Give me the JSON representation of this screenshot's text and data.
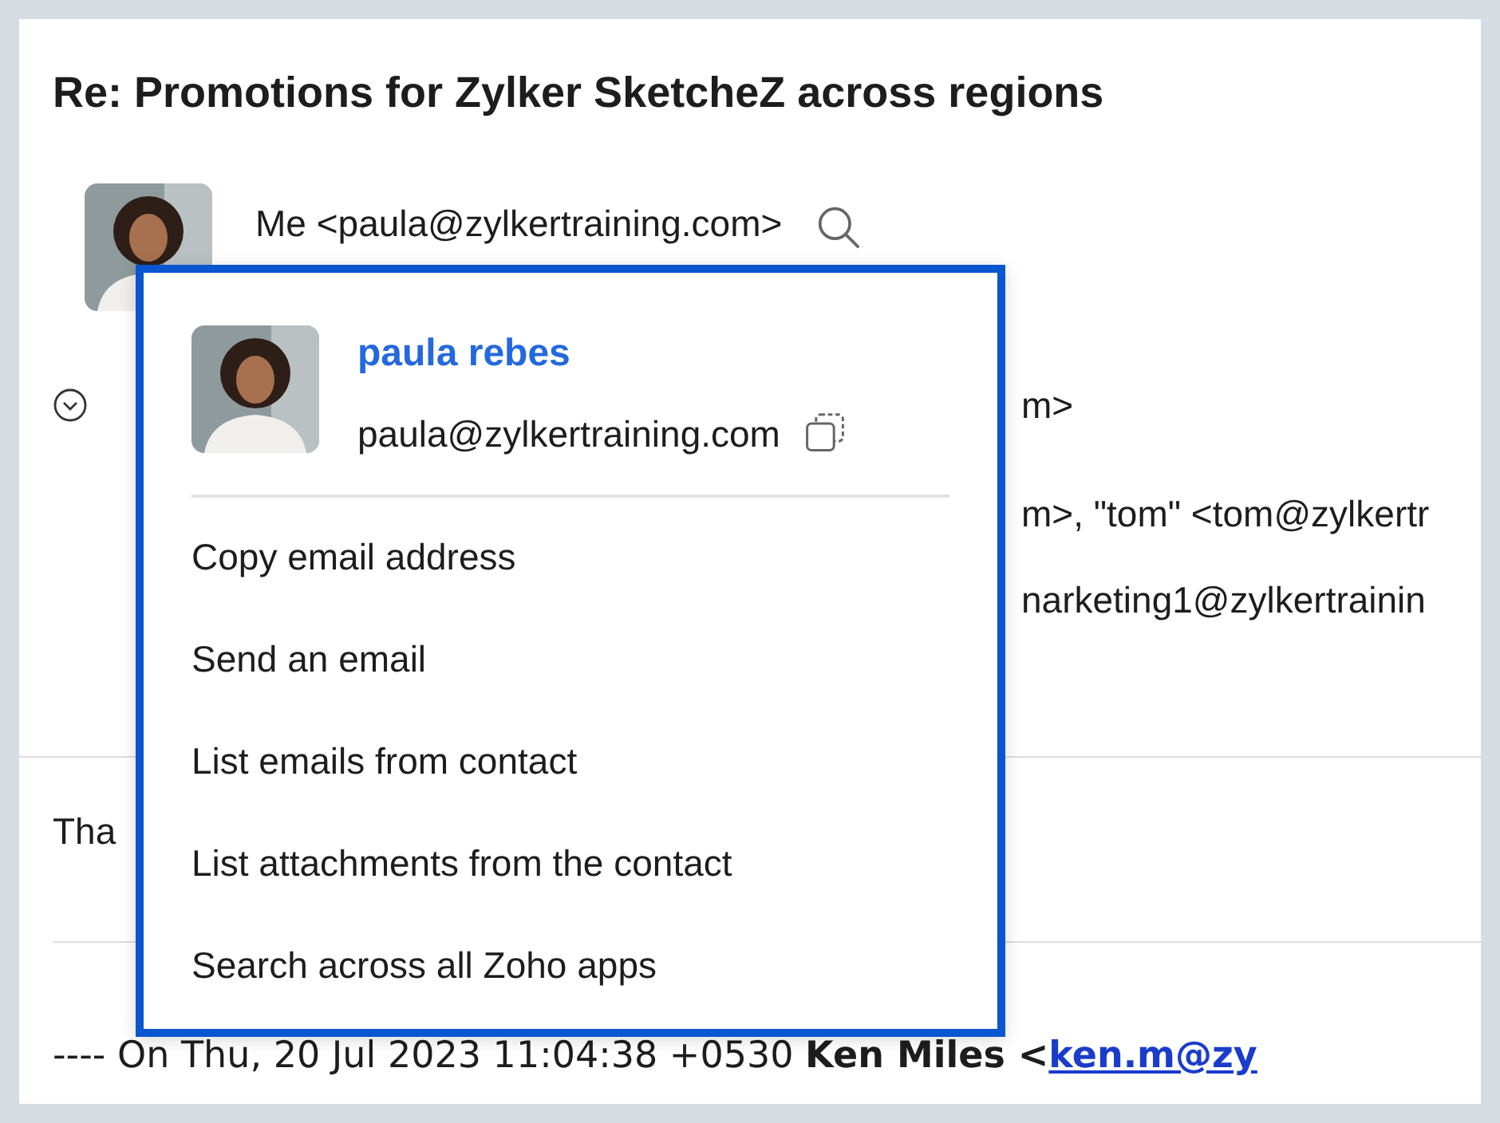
{
  "subject": "Re: Promotions for Zylker SketcheZ across regions",
  "sender": {
    "text": "Me <paula@zylkertraining.com>"
  },
  "recipient_fragments": [
    "m>",
    "m>, \"tom\" <tom@zylkertr",
    "narketing1@zylkertrainin"
  ],
  "body_fragment": "Tha",
  "quote": {
    "text": "---- On Thu, 20 Jul 2023 11:04:38 +0530 **Ken Miles <**",
    "link": "ken.m@zy"
  },
  "contact_card": {
    "name": "paula rebes",
    "email": "paula@zylkertraining.com",
    "actions": [
      "Copy email address",
      "Send an email",
      "List emails from contact",
      "List attachments from the contact",
      "Search across all Zoho apps"
    ]
  }
}
